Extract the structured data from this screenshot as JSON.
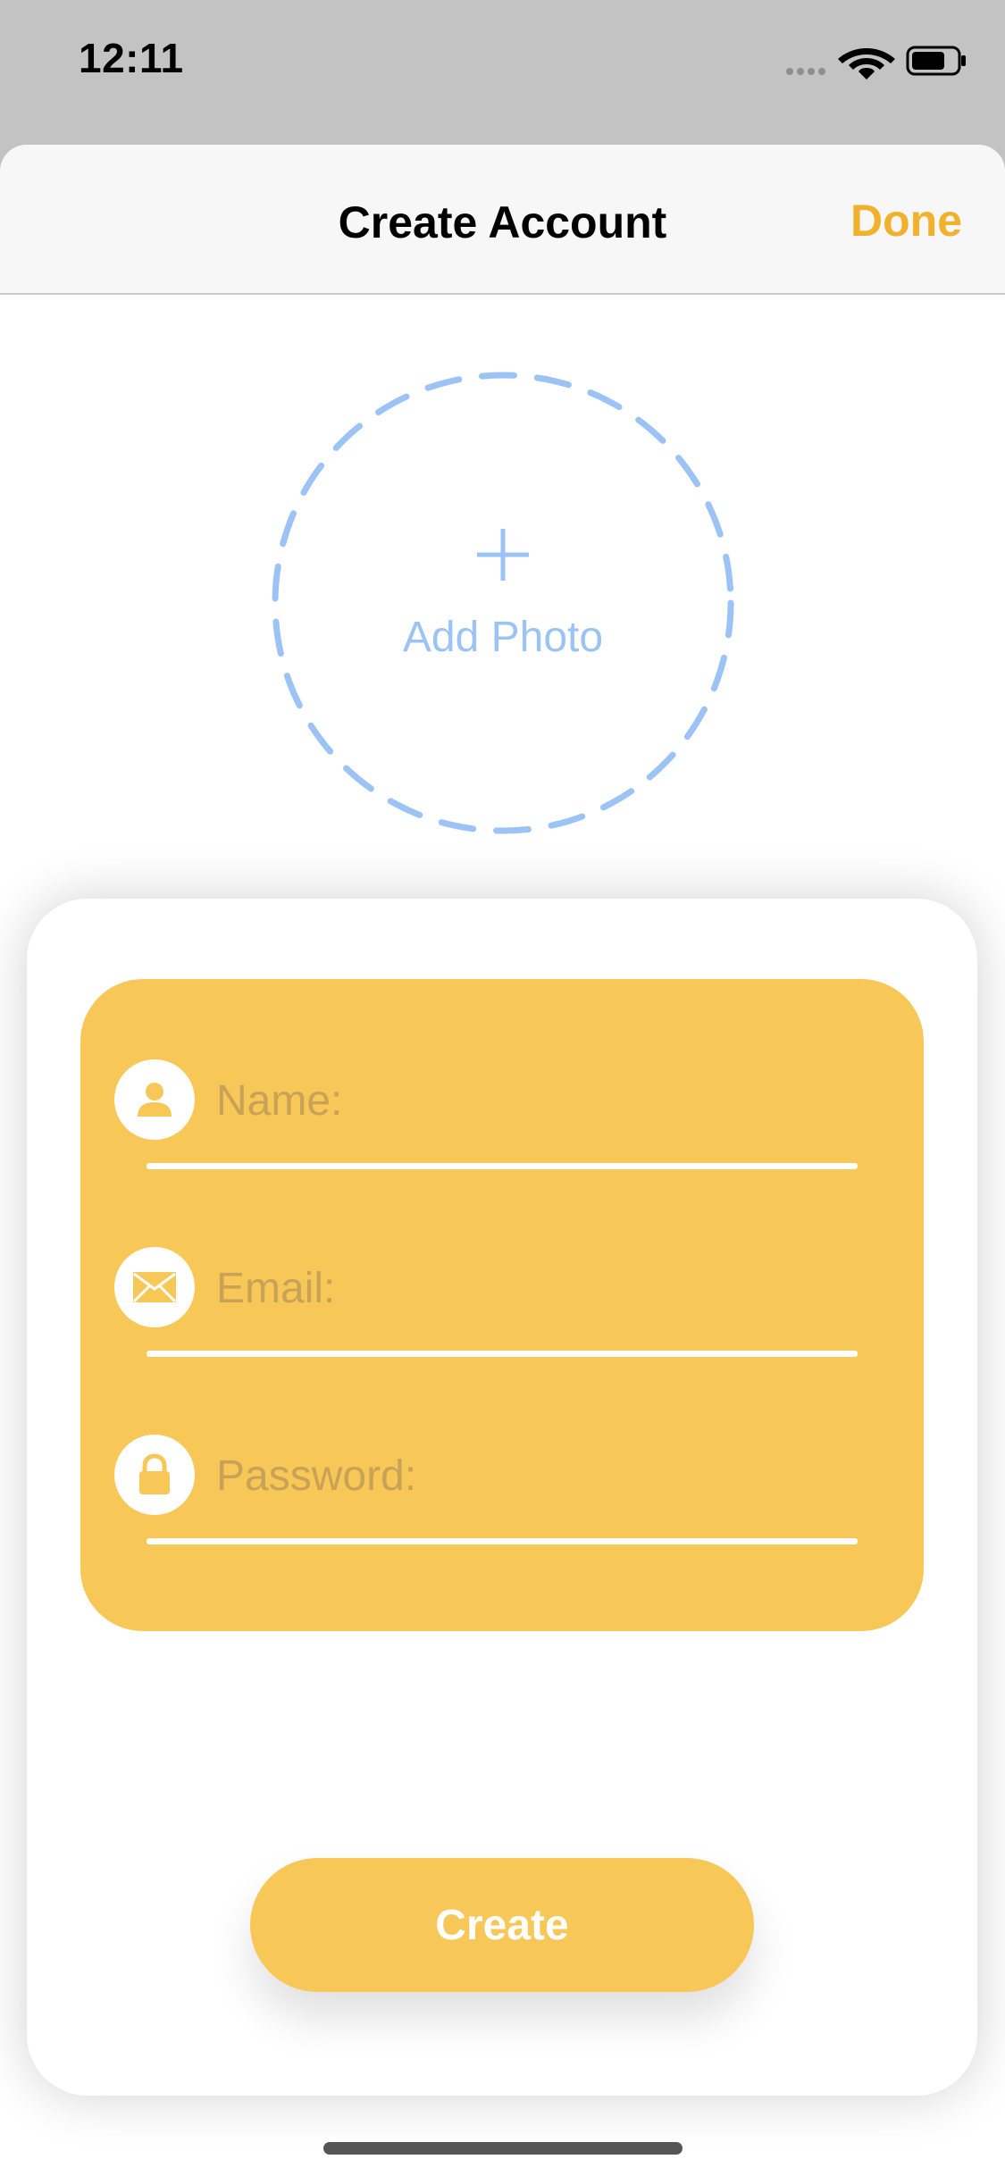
{
  "status_bar": {
    "time": "12:11",
    "icons": [
      "signal-icon",
      "wifi-icon",
      "battery-icon"
    ]
  },
  "navbar": {
    "title": "Create Account",
    "done_label": "Done"
  },
  "photo": {
    "add_label": "Add Photo",
    "icon": "plus-icon"
  },
  "form": {
    "fields": [
      {
        "icon": "person-icon",
        "placeholder": "Name:",
        "value": ""
      },
      {
        "icon": "envelope-icon",
        "placeholder": "Email:",
        "value": ""
      },
      {
        "icon": "lock-icon",
        "placeholder": "Password:",
        "value": ""
      }
    ],
    "submit_label": "Create"
  },
  "colors": {
    "accent": "#f7c758",
    "done": "#f2b12c",
    "photo_dash": "#9cc3f5",
    "placeholder": "#c8a257"
  }
}
